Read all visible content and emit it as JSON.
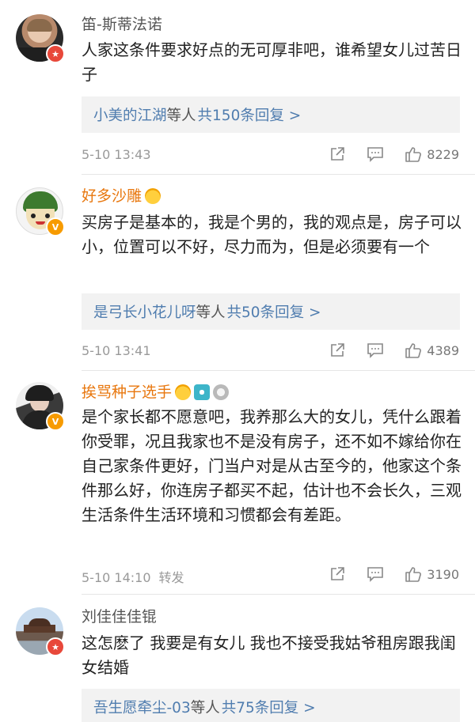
{
  "colors": {
    "link": "#507daf",
    "orange_name": "#e8770e",
    "meta": "#999999",
    "reply_bg": "#f2f2f2"
  },
  "comments": [
    {
      "username": "笛-斯蒂法诺",
      "name_style": "plain",
      "verify": "red-star",
      "text": "人家这条件要求好点的无可厚非吧，谁希望女儿过苦日子",
      "reply_users": "小美的江湖",
      "reply_etc": "等人",
      "reply_count": "共150条回复 >",
      "time": "5-10 13:43",
      "forward": "",
      "likes": "8229",
      "icons": [
        "share-icon",
        "comment-icon",
        "like-icon"
      ]
    },
    {
      "username": "好多沙雕",
      "name_style": "orange",
      "verify": "orange-v",
      "badges": [
        "smile-crown-badge"
      ],
      "text": "买房子是基本的，我是个男的，我的观点是，房子可以小，位置可以不好，尽力而为，但是必须要有一个",
      "reply_users": "是弓长小花儿呀",
      "reply_etc": "等人",
      "reply_count": "共50条回复 >",
      "time": "5-10 13:41",
      "forward": "",
      "likes": "4389",
      "icons": [
        "share-icon",
        "comment-icon",
        "like-icon"
      ]
    },
    {
      "username": "挨骂种子选手",
      "name_style": "orange",
      "verify": "orange-v",
      "badges": [
        "smile-crown-badge",
        "camera-badge",
        "medal-badge"
      ],
      "text": "是个家长都不愿意吧，我养那么大的女儿，凭什么跟着你受罪，况且我家也不是没有房子，还不如不嫁给你在自己家条件更好，门当户对是从古至今的，他家这个条件那么好，你连房子都买不起，估计也不会长久，三观生活条件生活环境和习惯都会有差距。",
      "reply_users": "",
      "reply_etc": "",
      "reply_count": "",
      "time": "5-10 14:10",
      "forward": "转发",
      "likes": "3190",
      "icons": [
        "share-icon",
        "comment-icon",
        "like-icon"
      ]
    },
    {
      "username": "刘佳佳佳锟",
      "name_style": "plain",
      "verify": "red-star",
      "text": "这怎麽了 我要是有女儿 我也不接受我姑爷租房跟我闺女结婚",
      "reply_users": "吾生愿牵尘-03",
      "reply_etc": "等人",
      "reply_count": "共75条回复 >",
      "time": "",
      "forward": "",
      "likes": "",
      "icons": []
    }
  ]
}
